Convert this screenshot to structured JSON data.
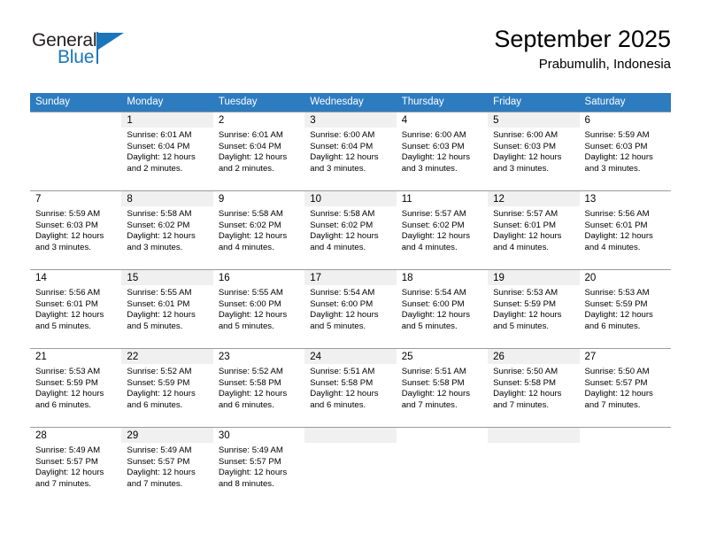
{
  "brand": {
    "name_top": "General",
    "name_bottom": "Blue",
    "triangle_icon": "triangle-icon",
    "accent_color": "#1b75bb"
  },
  "header": {
    "month_title": "September 2025",
    "location": "Prabumulih, Indonesia"
  },
  "theme": {
    "header_bg": "#2d7cc0",
    "shaded_cell_bg": "#f0f0f0",
    "grid_line": "#9b9b9b"
  },
  "calendar": {
    "weekday_headers": [
      "Sunday",
      "Monday",
      "Tuesday",
      "Wednesday",
      "Thursday",
      "Friday",
      "Saturday"
    ],
    "weeks": [
      [
        {
          "day": "",
          "sunrise": "",
          "sunset": "",
          "daylight_line1": "",
          "daylight_line2": ""
        },
        {
          "day": "1",
          "sunrise": "Sunrise: 6:01 AM",
          "sunset": "Sunset: 6:04 PM",
          "daylight_line1": "Daylight: 12 hours",
          "daylight_line2": "and 2 minutes."
        },
        {
          "day": "2",
          "sunrise": "Sunrise: 6:01 AM",
          "sunset": "Sunset: 6:04 PM",
          "daylight_line1": "Daylight: 12 hours",
          "daylight_line2": "and 2 minutes."
        },
        {
          "day": "3",
          "sunrise": "Sunrise: 6:00 AM",
          "sunset": "Sunset: 6:04 PM",
          "daylight_line1": "Daylight: 12 hours",
          "daylight_line2": "and 3 minutes."
        },
        {
          "day": "4",
          "sunrise": "Sunrise: 6:00 AM",
          "sunset": "Sunset: 6:03 PM",
          "daylight_line1": "Daylight: 12 hours",
          "daylight_line2": "and 3 minutes."
        },
        {
          "day": "5",
          "sunrise": "Sunrise: 6:00 AM",
          "sunset": "Sunset: 6:03 PM",
          "daylight_line1": "Daylight: 12 hours",
          "daylight_line2": "and 3 minutes."
        },
        {
          "day": "6",
          "sunrise": "Sunrise: 5:59 AM",
          "sunset": "Sunset: 6:03 PM",
          "daylight_line1": "Daylight: 12 hours",
          "daylight_line2": "and 3 minutes."
        }
      ],
      [
        {
          "day": "7",
          "sunrise": "Sunrise: 5:59 AM",
          "sunset": "Sunset: 6:03 PM",
          "daylight_line1": "Daylight: 12 hours",
          "daylight_line2": "and 3 minutes."
        },
        {
          "day": "8",
          "sunrise": "Sunrise: 5:58 AM",
          "sunset": "Sunset: 6:02 PM",
          "daylight_line1": "Daylight: 12 hours",
          "daylight_line2": "and 3 minutes."
        },
        {
          "day": "9",
          "sunrise": "Sunrise: 5:58 AM",
          "sunset": "Sunset: 6:02 PM",
          "daylight_line1": "Daylight: 12 hours",
          "daylight_line2": "and 4 minutes."
        },
        {
          "day": "10",
          "sunrise": "Sunrise: 5:58 AM",
          "sunset": "Sunset: 6:02 PM",
          "daylight_line1": "Daylight: 12 hours",
          "daylight_line2": "and 4 minutes."
        },
        {
          "day": "11",
          "sunrise": "Sunrise: 5:57 AM",
          "sunset": "Sunset: 6:02 PM",
          "daylight_line1": "Daylight: 12 hours",
          "daylight_line2": "and 4 minutes."
        },
        {
          "day": "12",
          "sunrise": "Sunrise: 5:57 AM",
          "sunset": "Sunset: 6:01 PM",
          "daylight_line1": "Daylight: 12 hours",
          "daylight_line2": "and 4 minutes."
        },
        {
          "day": "13",
          "sunrise": "Sunrise: 5:56 AM",
          "sunset": "Sunset: 6:01 PM",
          "daylight_line1": "Daylight: 12 hours",
          "daylight_line2": "and 4 minutes."
        }
      ],
      [
        {
          "day": "14",
          "sunrise": "Sunrise: 5:56 AM",
          "sunset": "Sunset: 6:01 PM",
          "daylight_line1": "Daylight: 12 hours",
          "daylight_line2": "and 5 minutes."
        },
        {
          "day": "15",
          "sunrise": "Sunrise: 5:55 AM",
          "sunset": "Sunset: 6:01 PM",
          "daylight_line1": "Daylight: 12 hours",
          "daylight_line2": "and 5 minutes."
        },
        {
          "day": "16",
          "sunrise": "Sunrise: 5:55 AM",
          "sunset": "Sunset: 6:00 PM",
          "daylight_line1": "Daylight: 12 hours",
          "daylight_line2": "and 5 minutes."
        },
        {
          "day": "17",
          "sunrise": "Sunrise: 5:54 AM",
          "sunset": "Sunset: 6:00 PM",
          "daylight_line1": "Daylight: 12 hours",
          "daylight_line2": "and 5 minutes."
        },
        {
          "day": "18",
          "sunrise": "Sunrise: 5:54 AM",
          "sunset": "Sunset: 6:00 PM",
          "daylight_line1": "Daylight: 12 hours",
          "daylight_line2": "and 5 minutes."
        },
        {
          "day": "19",
          "sunrise": "Sunrise: 5:53 AM",
          "sunset": "Sunset: 5:59 PM",
          "daylight_line1": "Daylight: 12 hours",
          "daylight_line2": "and 5 minutes."
        },
        {
          "day": "20",
          "sunrise": "Sunrise: 5:53 AM",
          "sunset": "Sunset: 5:59 PM",
          "daylight_line1": "Daylight: 12 hours",
          "daylight_line2": "and 6 minutes."
        }
      ],
      [
        {
          "day": "21",
          "sunrise": "Sunrise: 5:53 AM",
          "sunset": "Sunset: 5:59 PM",
          "daylight_line1": "Daylight: 12 hours",
          "daylight_line2": "and 6 minutes."
        },
        {
          "day": "22",
          "sunrise": "Sunrise: 5:52 AM",
          "sunset": "Sunset: 5:59 PM",
          "daylight_line1": "Daylight: 12 hours",
          "daylight_line2": "and 6 minutes."
        },
        {
          "day": "23",
          "sunrise": "Sunrise: 5:52 AM",
          "sunset": "Sunset: 5:58 PM",
          "daylight_line1": "Daylight: 12 hours",
          "daylight_line2": "and 6 minutes."
        },
        {
          "day": "24",
          "sunrise": "Sunrise: 5:51 AM",
          "sunset": "Sunset: 5:58 PM",
          "daylight_line1": "Daylight: 12 hours",
          "daylight_line2": "and 6 minutes."
        },
        {
          "day": "25",
          "sunrise": "Sunrise: 5:51 AM",
          "sunset": "Sunset: 5:58 PM",
          "daylight_line1": "Daylight: 12 hours",
          "daylight_line2": "and 7 minutes."
        },
        {
          "day": "26",
          "sunrise": "Sunrise: 5:50 AM",
          "sunset": "Sunset: 5:58 PM",
          "daylight_line1": "Daylight: 12 hours",
          "daylight_line2": "and 7 minutes."
        },
        {
          "day": "27",
          "sunrise": "Sunrise: 5:50 AM",
          "sunset": "Sunset: 5:57 PM",
          "daylight_line1": "Daylight: 12 hours",
          "daylight_line2": "and 7 minutes."
        }
      ],
      [
        {
          "day": "28",
          "sunrise": "Sunrise: 5:49 AM",
          "sunset": "Sunset: 5:57 PM",
          "daylight_line1": "Daylight: 12 hours",
          "daylight_line2": "and 7 minutes."
        },
        {
          "day": "29",
          "sunrise": "Sunrise: 5:49 AM",
          "sunset": "Sunset: 5:57 PM",
          "daylight_line1": "Daylight: 12 hours",
          "daylight_line2": "and 7 minutes."
        },
        {
          "day": "30",
          "sunrise": "Sunrise: 5:49 AM",
          "sunset": "Sunset: 5:57 PM",
          "daylight_line1": "Daylight: 12 hours",
          "daylight_line2": "and 8 minutes."
        },
        {
          "day": "",
          "sunrise": "",
          "sunset": "",
          "daylight_line1": "",
          "daylight_line2": ""
        },
        {
          "day": "",
          "sunrise": "",
          "sunset": "",
          "daylight_line1": "",
          "daylight_line2": ""
        },
        {
          "day": "",
          "sunrise": "",
          "sunset": "",
          "daylight_line1": "",
          "daylight_line2": ""
        },
        {
          "day": "",
          "sunrise": "",
          "sunset": "",
          "daylight_line1": "",
          "daylight_line2": ""
        }
      ]
    ]
  }
}
